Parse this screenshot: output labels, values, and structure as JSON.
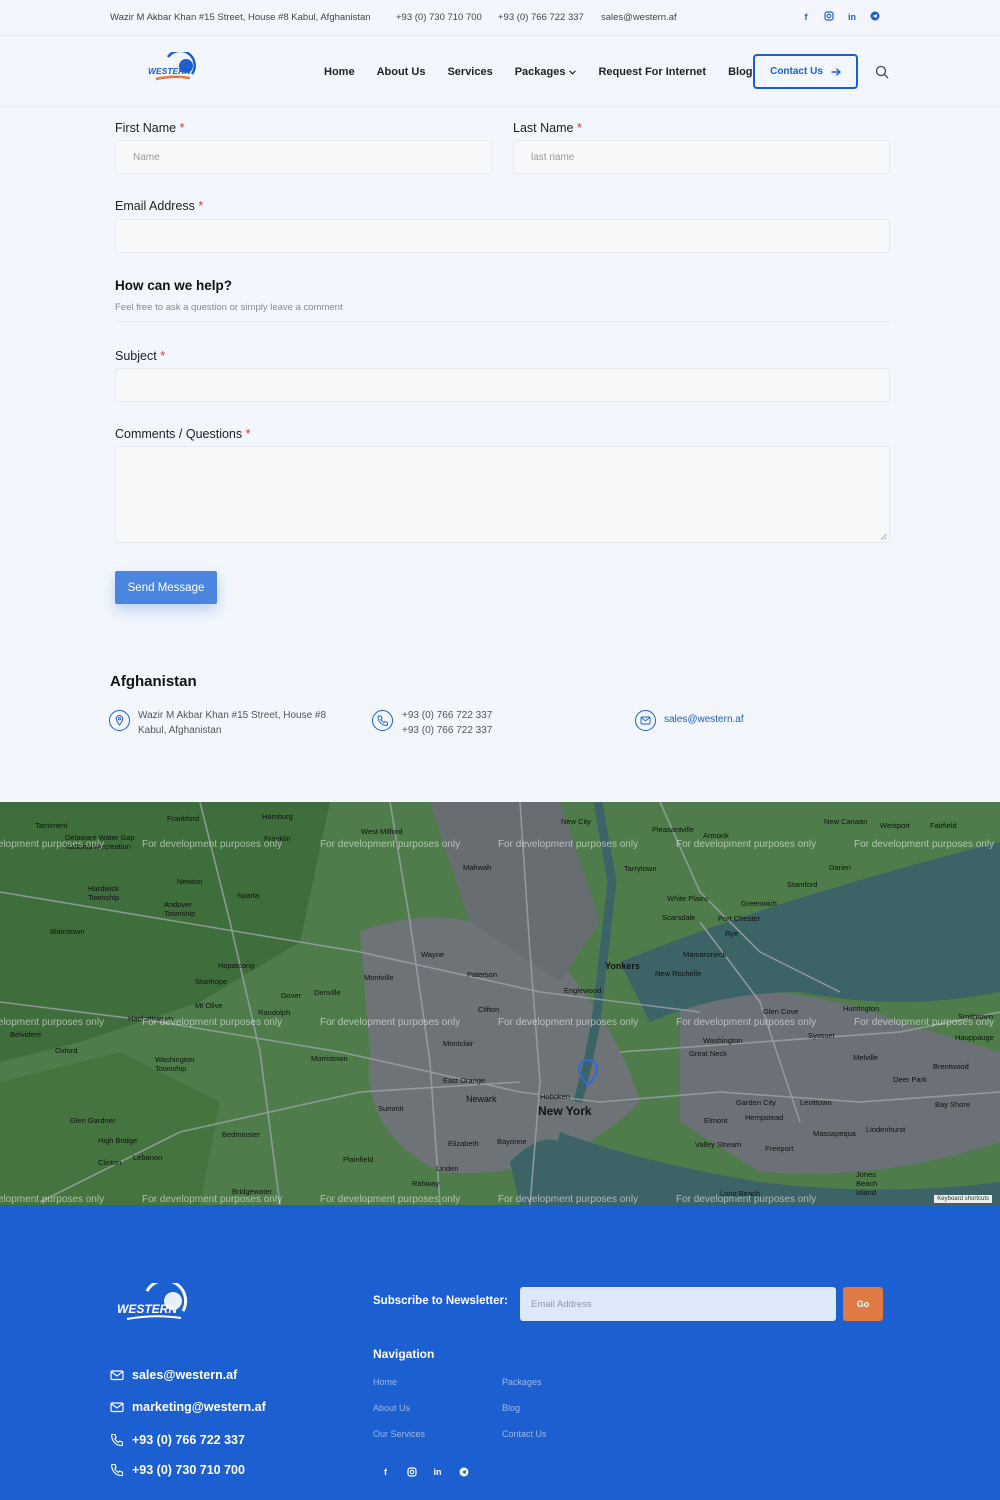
{
  "topbar": {
    "address": "Wazir M Akbar Khan #15 Street, House #8 Kabul, Afghanistan",
    "phone1": "+93 (0) 730 710 700",
    "phone2": "+93 (0) 766 722 337",
    "email": "sales@western.af",
    "socials": [
      "facebook-icon",
      "instagram-icon",
      "linkedin-icon",
      "telegram-icon"
    ]
  },
  "nav": {
    "logo_text": "WESTERN",
    "links": [
      "Home",
      "About Us",
      "Services",
      "Packages",
      "Request For Internet",
      "Blog"
    ],
    "contact_button": "Contact Us"
  },
  "form": {
    "first_name_label": "First Name",
    "first_name_placeholder": "Name",
    "last_name_label": "Last Name",
    "last_name_placeholder": "last name",
    "email_label": "Email Address",
    "help_title": "How can we help?",
    "help_subtitle": "Feel free to ask a question or simply leave a comment",
    "subject_label": "Subject",
    "comments_label": "Comments / Questions",
    "required_marker": "*",
    "submit_label": "Send Message"
  },
  "contact": {
    "country": "Afghanistan",
    "address_line1": "Wazir M Akbar Khan #15 Street, House #8",
    "address_line2": "Kabul, Afghanistan",
    "phone1": "+93 (0) 766 722 337",
    "phone2": "+93 (0) 766 722 337",
    "email": "sales@western.af"
  },
  "map": {
    "watermark": "For development purposes only",
    "places": [
      "Tamiment",
      "Frankford",
      "Hamburg",
      "West Milford",
      "New City",
      "Pleasantville",
      "Armonk",
      "New Canaan",
      "Westport",
      "Fairfield",
      "Delaware Water Gap National Recreation",
      "Franklin",
      "Mahwah",
      "Tarrytown",
      "Darien",
      "Newton",
      "Sparta",
      "White Plains",
      "Stamford",
      "Hardwick Township",
      "Andover Township",
      "Scarsdale",
      "Port Chester",
      "Greenwich",
      "Blairstown",
      "Wayne",
      "Rye",
      "Mamaroneck",
      "Hopatcong",
      "Yonkers",
      "Paterson",
      "New Rochelle",
      "Stanhope",
      "Montville",
      "Dover",
      "Denville",
      "Englewood",
      "Randolph",
      "Mt Olive",
      "Hackettstown",
      "Clifton",
      "Glen Cove",
      "Huntington",
      "Smithtown",
      "Belvidere",
      "Montclair",
      "Washington",
      "Syosset",
      "Oxford",
      "Great Neck",
      "Hauppauge",
      "Washington Township",
      "Morristown",
      "East Orange",
      "Melville",
      "Brentwood",
      "Newark",
      "Hoboken",
      "New York",
      "Deer Park",
      "Summit",
      "Garden City",
      "Levittown",
      "Bay Shore",
      "Glen Gardner",
      "Bedminster",
      "Elmont",
      "Hempstead",
      "Lindenhurst",
      "High Bridge",
      "Elizabeth",
      "Bayonne",
      "Valley Stream",
      "Massapequa",
      "Freeport",
      "Clinton",
      "Lebanon",
      "Plainfield",
      "Linden",
      "Rahway",
      "Jones Beach Island",
      "Bridgewater",
      "Long Beach"
    ],
    "keyboard_shortcuts": "Keyboard shortcuts"
  },
  "footer": {
    "logo_text": "WESTERN",
    "email1": "sales@western.af",
    "email2": "marketing@western.af",
    "phone1": "+93 (0) 766 722 337",
    "phone2": "+93 (0) 730 710 700",
    "newsletter_label": "Subscribe to Newsletter:",
    "newsletter_placeholder": "Email Address",
    "newsletter_button": "Go",
    "navigation_title": "Navigation",
    "nav_col1": [
      "Home",
      "About Us",
      "Our Services"
    ],
    "nav_col2": [
      "Packages",
      "Blog",
      "Contact Us"
    ]
  },
  "colors": {
    "brand_blue": "#1b5fd1",
    "button_blue": "#4a86e0",
    "accent_orange": "#e07a44",
    "map_green": "#4e7d4b"
  }
}
